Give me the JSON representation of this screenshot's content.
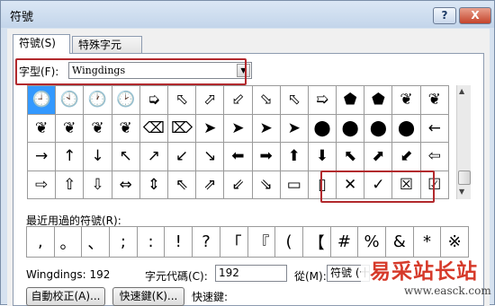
{
  "window": {
    "title": "符號",
    "help_label": "?",
    "close_label": "X"
  },
  "tabs": [
    {
      "label": "符號(S)"
    },
    {
      "label": "特殊字元(P)"
    }
  ],
  "font": {
    "label": "字型(F):",
    "value": "Wingdings"
  },
  "symbols": [
    [
      "🕘",
      "🕙",
      "🕐",
      "🕑",
      "➭",
      "⬁",
      "⬀",
      "⬃",
      "⬂",
      "⬁",
      "➯",
      "⬟",
      "⬟",
      "❦",
      "❦"
    ],
    [
      "❦",
      "❦",
      "❦",
      "❦",
      "⌫",
      "⌦",
      "➤",
      "➤",
      "➤",
      "➤",
      "⬤",
      "⬤",
      "⬤",
      "⬤",
      "←"
    ],
    [
      "→",
      "↑",
      "↓",
      "↖",
      "↗",
      "↙",
      "↘",
      "⬅",
      "➡",
      "⬆",
      "⬇",
      "⬉",
      "⬈",
      "⬋",
      "⇦"
    ],
    [
      "⇨",
      "⇧",
      "⇩",
      "⇔",
      "⇕",
      "⇖",
      "⇗",
      "⇙",
      "⇘",
      "▭",
      "▯",
      "✕",
      "✓",
      "☒",
      "☑"
    ]
  ],
  "recent": {
    "label": "最近用過的符號(R):",
    "items": [
      ",",
      "。",
      "、",
      ";",
      ":",
      "!",
      "?",
      "「",
      "『",
      "(",
      "【",
      "#",
      "%",
      "&",
      "*",
      "※"
    ]
  },
  "info": {
    "font_code": "Wingdings: 192",
    "code_label": "字元代碼(C):",
    "code_value": "192",
    "from_label": "從(M):",
    "from_value": "符號 (十"
  },
  "buttons": {
    "autocorrect": "自動校正(A)...",
    "shortcut": "快速鍵(K)...",
    "shortcut_label": "快速鍵:"
  },
  "watermark": {
    "logo": "易采站长站",
    "url": "www.easck.com"
  },
  "colors": {
    "selected": "#3399ff",
    "highlight": "#b2292d",
    "watermark": "#d63a2a"
  }
}
